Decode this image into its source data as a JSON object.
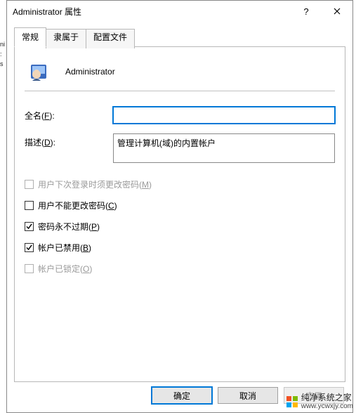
{
  "window": {
    "title": "Administrator 属性",
    "help_symbol": "?",
    "close_symbol": "×"
  },
  "tabs": [
    {
      "label": "常规",
      "active": true
    },
    {
      "label": "隶属于",
      "active": false
    },
    {
      "label": "配置文件",
      "active": false
    }
  ],
  "general": {
    "username": "Administrator",
    "full_name_label": "全名(",
    "full_name_key": "F",
    "full_name_label_tail": "):",
    "full_name_value": "",
    "description_label": "描述(",
    "description_key": "D",
    "description_label_tail": "):",
    "description_value": "管理计算机(域)的内置帐户"
  },
  "checkboxes": [
    {
      "label": "用户下次登录时须更改密码(",
      "key": "M",
      "tail": ")",
      "checked": false,
      "disabled": true
    },
    {
      "label": "用户不能更改密码(",
      "key": "C",
      "tail": ")",
      "checked": false,
      "disabled": false
    },
    {
      "label": "密码永不过期(",
      "key": "P",
      "tail": ")",
      "checked": true,
      "disabled": false
    },
    {
      "label": "帐户已禁用(",
      "key": "B",
      "tail": ")",
      "checked": true,
      "disabled": false
    },
    {
      "label": "帐户已锁定(",
      "key": "O",
      "tail": ")",
      "checked": false,
      "disabled": true
    }
  ],
  "buttons": {
    "ok": "确定",
    "cancel": "取消",
    "apply": "应用",
    "apply_key": "A"
  },
  "watermark": {
    "name": "纯净系统之家",
    "url": "www.ycwxjy.com"
  },
  "left_strip": [
    "ni",
    ":",
    "s"
  ]
}
